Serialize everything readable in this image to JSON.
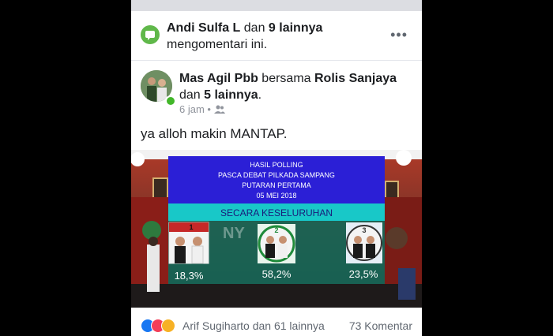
{
  "notification": {
    "actor": "Andi Sulfa L",
    "conj": " dan ",
    "others": "9 lainnya",
    "line2": "mengomentari ini.",
    "more_icon": "more-horizontal-icon"
  },
  "post": {
    "author": "Mas Agil Pbb",
    "with_word": " bersama ",
    "tagged": "Rolis Sanjaya",
    "conj": "dan ",
    "tagged_others": "5 lainnya",
    "period": ".",
    "time": "6 jam",
    "sep": " • ",
    "privacy_icon": "friends-icon",
    "text": "ya alloh makin MANTAP."
  },
  "poll": {
    "title_lines": [
      "HASIL POLLING",
      "PASCA DEBAT PILKADA SAMPANG",
      "PUTARAN PERTAMA",
      "05 MEI 2018"
    ],
    "subtitle": "SECARA KESELURUHAN",
    "candidates": [
      {
        "number": "1",
        "percent": "18,3%"
      },
      {
        "number": "2",
        "percent": "58,2%"
      },
      {
        "number": "3",
        "percent": "23,5%"
      }
    ],
    "banner_text": "NY",
    "colors": {
      "title_bg": "#2b1fd6",
      "subtitle_bg": "#18c8c8",
      "panel_bg": "#0f6a5a"
    }
  },
  "footer": {
    "reaction_icons": [
      "like-icon",
      "love-icon",
      "haha-icon"
    ],
    "names": "Arif Sugiharto dan 61 lainnya",
    "comments": "73 Komentar"
  }
}
